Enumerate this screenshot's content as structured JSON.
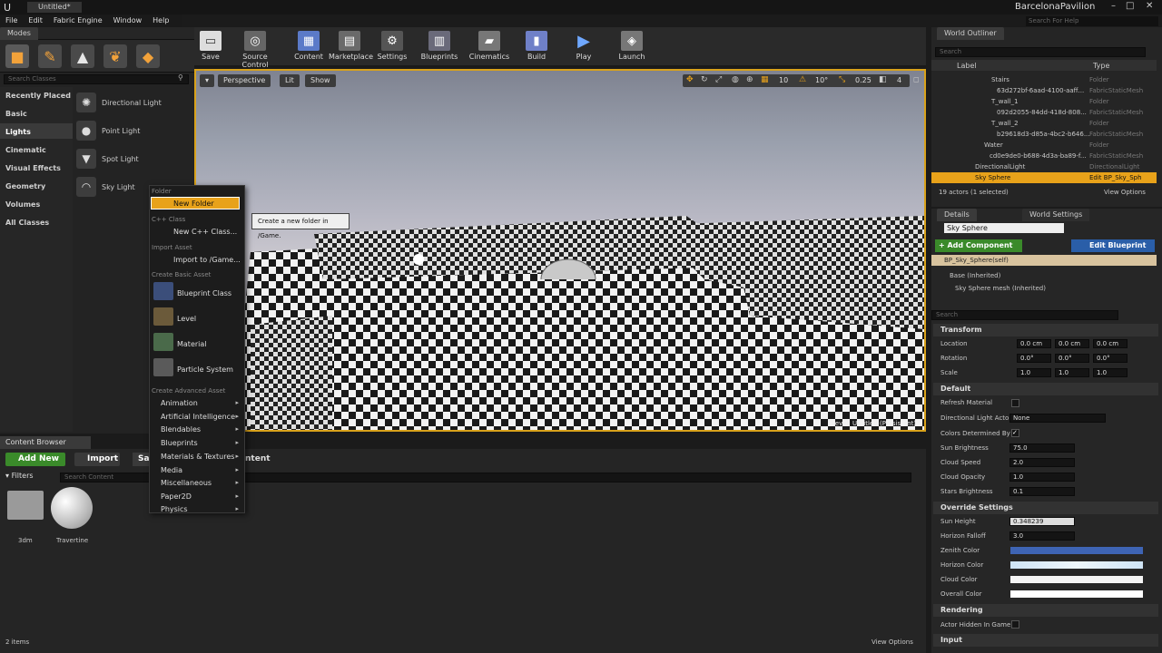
{
  "window": {
    "doc_tab": "Untitled*",
    "project": "BarcelonaPavilion",
    "search_help": "Search For Help"
  },
  "menu": [
    "File",
    "Edit",
    "Fabric Engine",
    "Window",
    "Help"
  ],
  "modes": {
    "tab": "Modes",
    "search_placeholder": "Search Classes",
    "categories": [
      "Recently Placed",
      "Basic",
      "Lights",
      "Cinematic",
      "Visual Effects",
      "Geometry",
      "Volumes",
      "All Classes"
    ],
    "items": [
      "Directional Light",
      "Point Light",
      "Spot Light",
      "Sky Light"
    ]
  },
  "toolbar": [
    "Save",
    "Source Control",
    "Content",
    "Marketplace",
    "Settings",
    "Blueprints",
    "Cinematics",
    "Build",
    "Play",
    "Launch"
  ],
  "viewport": {
    "perspective": "Perspective",
    "lit": "Lit",
    "show": "Show",
    "snap_grid": "10",
    "snap_rot": "10°",
    "snap_scale": "0.25",
    "cam_speed": "4",
    "level_label": "Level:  Untitled (Persistent)"
  },
  "context_menu": {
    "h_folder": "Folder",
    "new_folder": "New Folder",
    "h_cpp": "C++ Class",
    "new_cpp": "New C++ Class...",
    "h_import": "Import Asset",
    "import_to": "Import to /Game...",
    "h_basic": "Create Basic Asset",
    "basic": [
      "Blueprint Class",
      "Level",
      "Material",
      "Particle System"
    ],
    "h_adv": "Create Advanced Asset",
    "adv": [
      "Animation",
      "Artificial Intelligence",
      "Blendables",
      "Blueprints",
      "Materials & Textures",
      "Media",
      "Miscellaneous",
      "Paper2D",
      "Physics"
    ]
  },
  "tooltip": "Create a new folder in /Game.",
  "content_browser": {
    "tab": "Content Browser",
    "add_new": "Add New",
    "import": "Import",
    "save_trunc": "Sa",
    "content_trunc": "ntent",
    "filters": "Filters",
    "search_placeholder": "Search Content",
    "assets": [
      "3dm",
      "Travertine"
    ],
    "count": "2 items",
    "view_options": "View Options"
  },
  "outliner": {
    "tab": "World Outliner",
    "search_placeholder": "Search",
    "col_label": "Label",
    "col_type": "Type",
    "rows": [
      {
        "label": "Stairs",
        "type": "Folder"
      },
      {
        "label": "63d272bf-6aad-4100-aaff...",
        "type": "FabricStaticMesh"
      },
      {
        "label": "T_wall_1",
        "type": "Folder"
      },
      {
        "label": "092d2055-84dd-418d-808...",
        "type": "FabricStaticMesh"
      },
      {
        "label": "T_wall_2",
        "type": "Folder"
      },
      {
        "label": "b29618d3-d85a-4bc2-b646...",
        "type": "FabricStaticMesh"
      },
      {
        "label": "Water",
        "type": "Folder"
      },
      {
        "label": "cd0e9de0-b688-4d3a-ba89-f...",
        "type": "FabricStaticMesh"
      },
      {
        "label": "DirectionalLight",
        "type": "DirectionalLight"
      },
      {
        "label": "Sky Sphere",
        "type": "Edit BP_Sky_Sph"
      }
    ],
    "status": "19 actors (1 selected)",
    "view_options": "View Options"
  },
  "details": {
    "tab": "Details",
    "tab2": "World Settings",
    "name": "Sky Sphere",
    "add_component": "+ Add Component",
    "edit_blueprint": "Edit Blueprint",
    "self_comp": "BP_Sky_Sphere(self)",
    "base": "Base (Inherited)",
    "mesh": "Sky Sphere mesh (Inherited)",
    "search_placeholder": "Search",
    "transform": "Transform",
    "location": "Location",
    "rotation": "Rotation",
    "scale": "Scale",
    "loc": [
      "0.0 cm",
      "0.0 cm",
      "0.0 cm"
    ],
    "rot": [
      "0.0°",
      "0.0°",
      "0.0°"
    ],
    "scl": [
      "1.0",
      "1.0",
      "1.0"
    ],
    "default": "Default",
    "refresh": "Refresh Material",
    "dir_light": "Directional Light Acto",
    "none": "None",
    "colors_det": "Colors Determined By",
    "sun_brightness": "Sun Brightness",
    "sun_brightness_v": "75.0",
    "cloud_speed": "Cloud Speed",
    "cloud_speed_v": "2.0",
    "cloud_opacity": "Cloud Opacity",
    "cloud_opacity_v": "1.0",
    "stars": "Stars Brightness",
    "stars_v": "0.1",
    "override": "Override Settings",
    "sun_height": "Sun Height",
    "sun_height_v": "0.348239",
    "horizon_falloff": "Horizon Falloff",
    "horizon_falloff_v": "3.0",
    "zenith": "Zenith Color",
    "horizon": "Horizon Color",
    "cloud_color": "Cloud Color",
    "overall": "Overall Color",
    "rendering": "Rendering",
    "hidden": "Actor Hidden In Game",
    "input": "Input"
  },
  "colors": {
    "accent": "#d9a21b",
    "highlight": "#e8a21a",
    "green": "#3a8a2a",
    "blue": "#2a5ea8",
    "zenith": "#3e64b4"
  }
}
